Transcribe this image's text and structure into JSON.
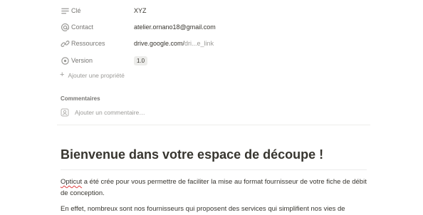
{
  "properties": [
    {
      "name": "Clé",
      "value": "XYZ",
      "icon": "text-lines-icon"
    },
    {
      "name": "Contact",
      "value": "atelier.ornano18@gmail.com",
      "icon": "at-sign-icon"
    },
    {
      "name": "Ressources",
      "value_main": "drive.google.com/",
      "value_faded": "dri...e_link",
      "icon": "link-icon"
    },
    {
      "name": "Version",
      "value": "1.0",
      "icon": "target-icon"
    }
  ],
  "add_property_label": "Ajouter une propriété",
  "comments": {
    "label": "Commentaires",
    "placeholder": "Ajouter un commentaire…"
  },
  "page": {
    "title": "Bienvenue dans votre espace de découpe !",
    "paragraph1_word": "Opticut",
    "paragraph1_rest": " a été crée pour vous permettre de faciliter la mise au format fournisseur de votre fiche de débit de conception.",
    "paragraph2": "En effet, nombreux sont nos fournisseurs qui proposent des services qui simplifient nos vies de"
  },
  "colors": {
    "text": "#37352f",
    "muted": "#9b9a97",
    "label": "#787774",
    "chip_bg": "#ececea",
    "divider": "#ededec",
    "spell_error": "#e03e3e"
  }
}
